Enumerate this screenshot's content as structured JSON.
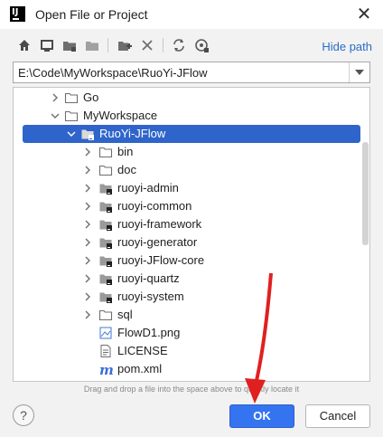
{
  "window": {
    "title": "Open File or Project",
    "app_icon_letter": "IJ"
  },
  "toolbar": {
    "buttons": [
      "home-icon",
      "desktop-icon",
      "project-folder-icon",
      "module-folder-icon",
      "new-folder-icon",
      "delete-icon",
      "refresh-icon",
      "show-hidden-icon"
    ],
    "hide_path_label": "Hide path"
  },
  "path": {
    "value": "E:\\Code\\MyWorkspace\\RuoYi-JFlow"
  },
  "tree": {
    "items": [
      {
        "label": "Go",
        "type": "folder",
        "expanded": false
      },
      {
        "label": "MyWorkspace",
        "type": "folder",
        "expanded": true
      },
      {
        "label": "RuoYi-JFlow",
        "type": "module",
        "expanded": true,
        "selected": true
      },
      {
        "label": "bin",
        "type": "folder",
        "expanded": false
      },
      {
        "label": "doc",
        "type": "folder",
        "expanded": false
      },
      {
        "label": "ruoyi-admin",
        "type": "module",
        "expanded": false
      },
      {
        "label": "ruoyi-common",
        "type": "module",
        "expanded": false
      },
      {
        "label": "ruoyi-framework",
        "type": "module",
        "expanded": false
      },
      {
        "label": "ruoyi-generator",
        "type": "module",
        "expanded": false
      },
      {
        "label": "ruoyi-JFlow-core",
        "type": "module",
        "expanded": false
      },
      {
        "label": "ruoyi-quartz",
        "type": "module",
        "expanded": false
      },
      {
        "label": "ruoyi-system",
        "type": "module",
        "expanded": false
      },
      {
        "label": "sql",
        "type": "folder",
        "expanded": false
      },
      {
        "label": "FlowD1.png",
        "type": "image"
      },
      {
        "label": "LICENSE",
        "type": "text"
      },
      {
        "label": "pom.xml",
        "type": "maven"
      }
    ]
  },
  "hint": "Drag and drop a file into the space above to quickly locate it",
  "buttons": {
    "help": "?",
    "ok": "OK",
    "cancel": "Cancel"
  },
  "colors": {
    "accent": "#3574f0",
    "selection": "#2f65ca",
    "link": "#2b6cc4",
    "annotation_arrow": "#e02020"
  }
}
